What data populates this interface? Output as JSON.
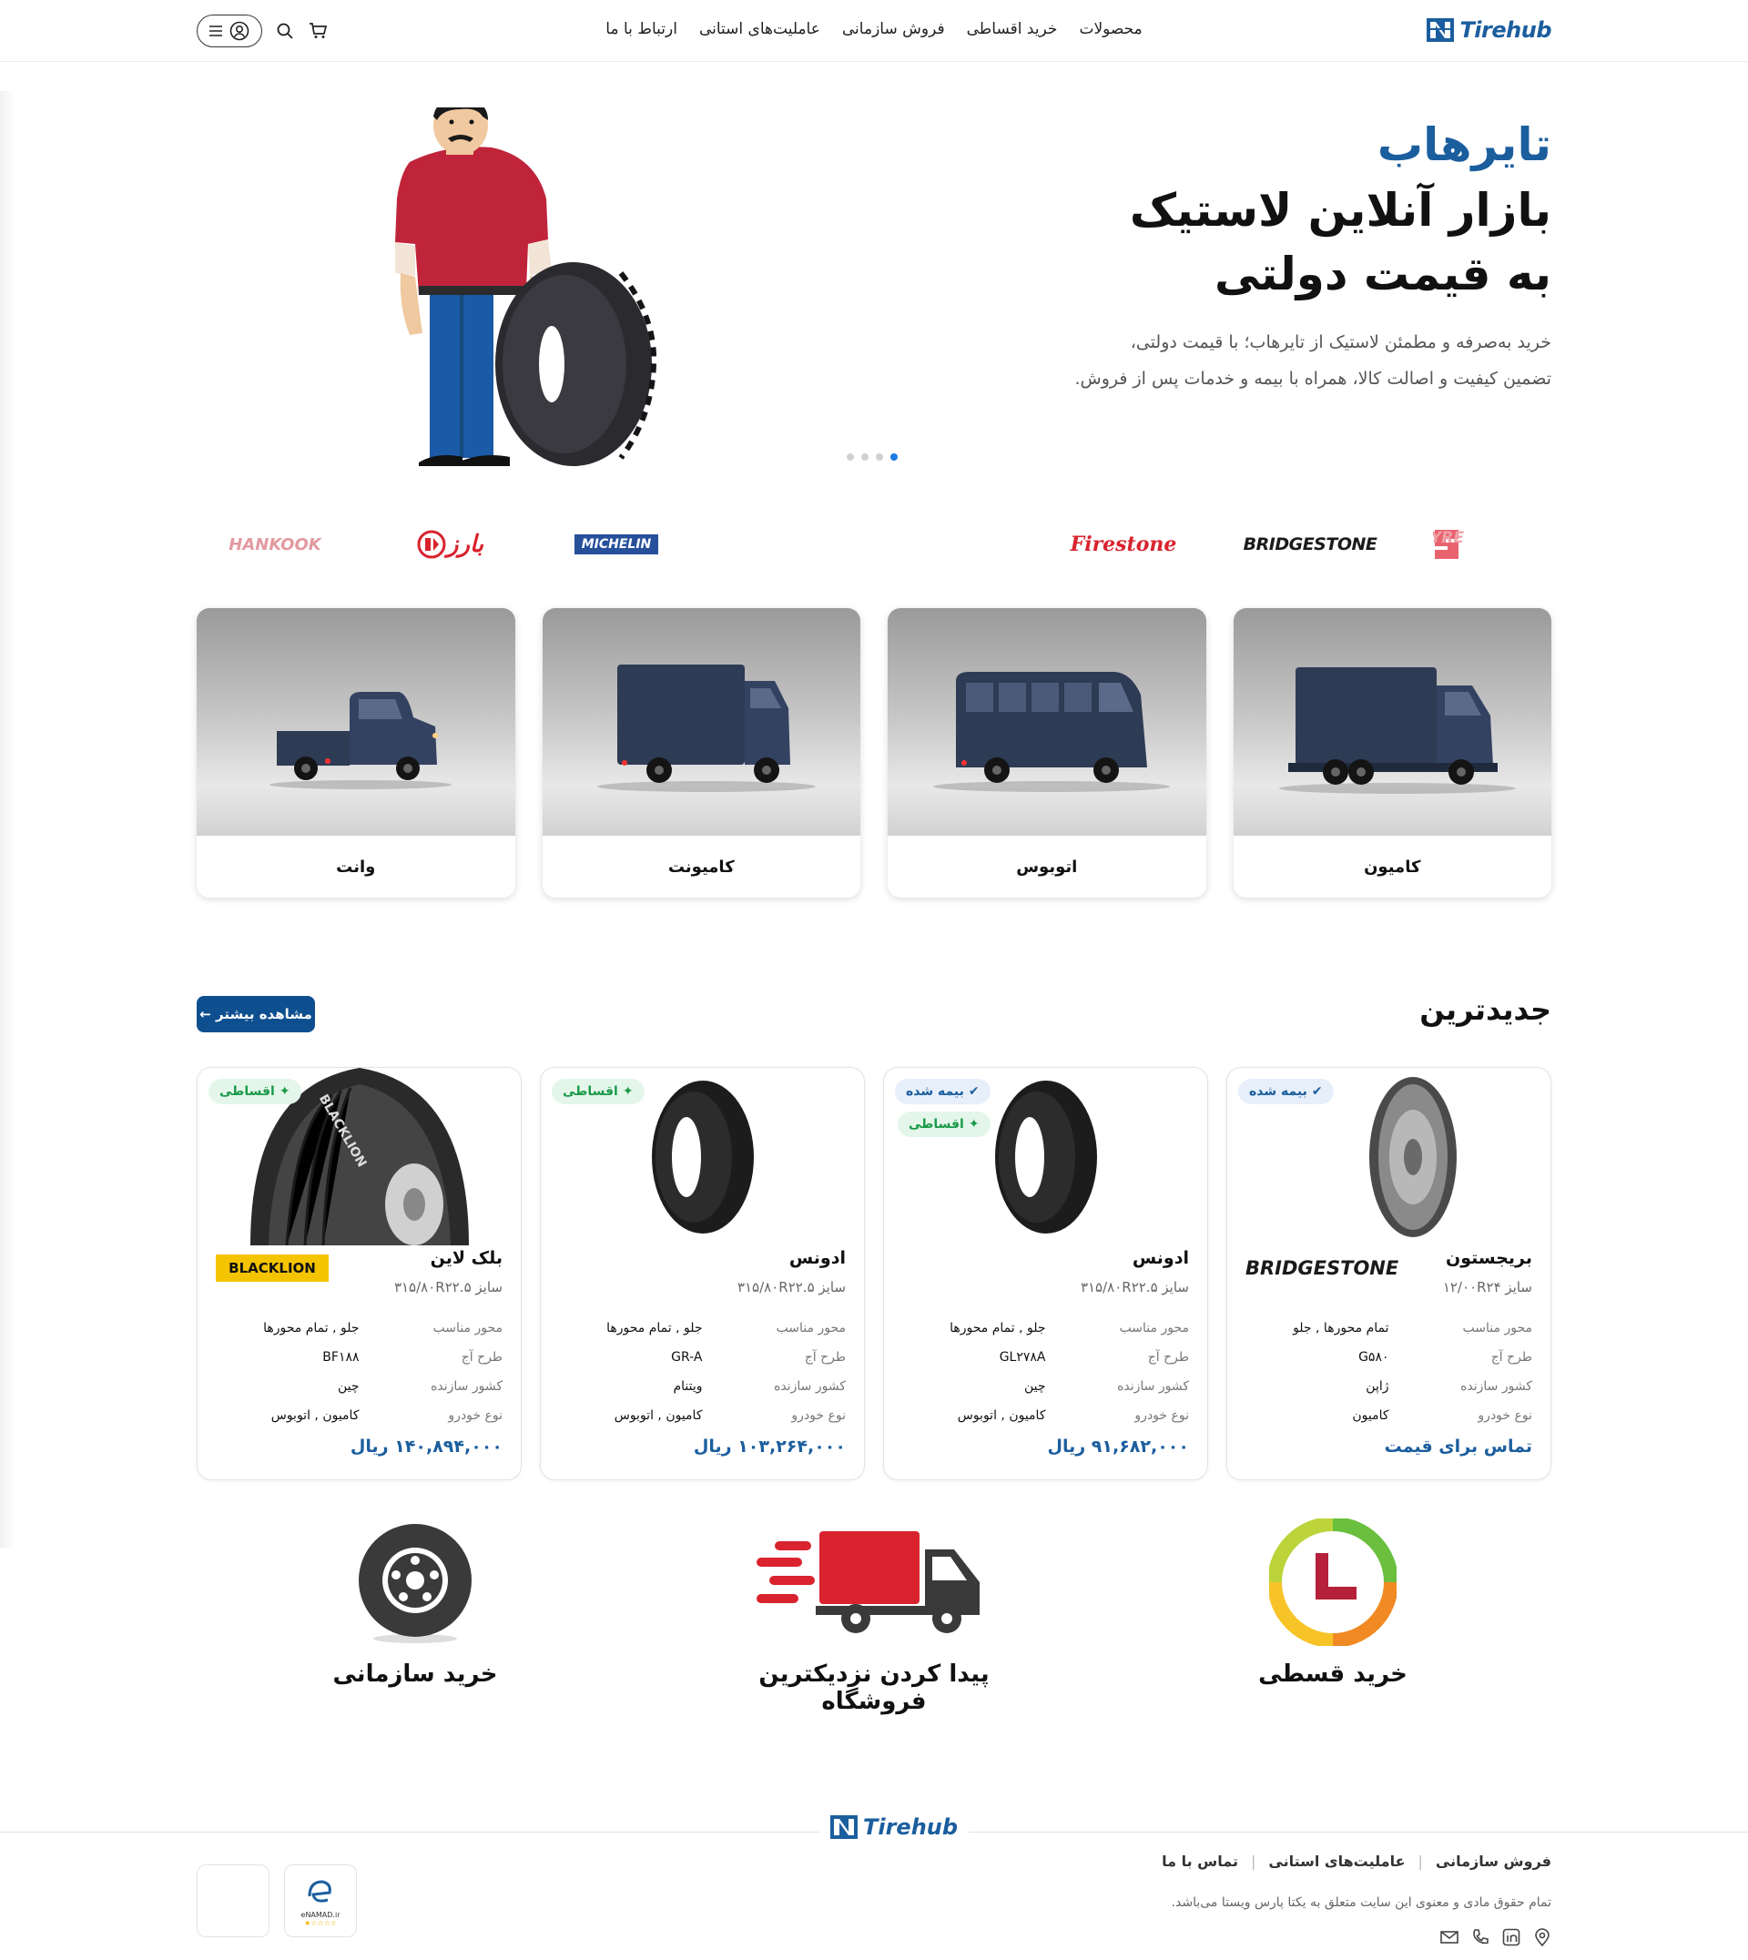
{
  "header": {
    "logo_text": "Tirehub",
    "nav": [
      "محصولات",
      "خرید اقساطی",
      "فروش سازمانی",
      "عاملیت‌های استانی",
      "ارتباط با ما"
    ]
  },
  "hero": {
    "title_accent": "تایرهاب",
    "title_line1": "بازار آنلاین لاستیک",
    "title_line2": "به قیمت دولتی",
    "desc_line1": "خرید به‌صرفه و مطمئن لاستیک از تایرهاب؛ با قیمت دولتی،",
    "desc_line2": "تضمین کیفیت و اصالت کالا، همراه با بیمه و خدمات پس از فروش.",
    "slides": 4,
    "active_slide": 4
  },
  "brands": [
    "SAMSON TYRE",
    "BRIDGESTONE",
    "Firestone",
    "MICHELIN",
    "بارز",
    "HANKOOK"
  ],
  "categories": [
    "کامیون",
    "اتوبوس",
    "کامیونت",
    "وانت"
  ],
  "newest": {
    "title": "جدیدترین",
    "more_label": "مشاهده بیشتر ←",
    "spec_labels": {
      "axle": "محور مناسب",
      "pattern": "طرح آج",
      "country": "کشور سازنده",
      "vehicle": "نوع خودرو"
    },
    "products": [
      {
        "name": "بریجستون",
        "size": "سایز ۱۲/۰۰R۲۴",
        "brand_logo": "BRIDGESTONE",
        "badges": [
          "بیمه شده"
        ],
        "axle": "تمام محورها , جلو",
        "pattern": "G۵۸۰",
        "country": "ژاپن",
        "vehicle": "کامیون",
        "price": "تماس برای قیمت"
      },
      {
        "name": "ادونس",
        "size": "سایز ۳۱۵/۸۰R۲۲.۵",
        "brand_logo": "",
        "badges": [
          "بیمه شده",
          "اقساطی"
        ],
        "axle": "جلو , تمام محورها",
        "pattern": "GL۲۷۸A",
        "country": "چین",
        "vehicle": "کامیون , اتوبوس",
        "price": "۹۱,۶۸۲,۰۰۰ ریال"
      },
      {
        "name": "ادونس",
        "size": "سایز ۳۱۵/۸۰R۲۲.۵",
        "brand_logo": "",
        "badges": [
          "اقساطی"
        ],
        "axle": "جلو , تمام محورها",
        "pattern": "GR-A",
        "country": "ویتنام",
        "vehicle": "کامیون , اتوبوس",
        "price": "۱۰۳,۲۶۴,۰۰۰ ریال"
      },
      {
        "name": "بلک لاین",
        "size": "سایز ۳۱۵/۸۰R۲۲.۵",
        "brand_logo": "BLACKLION",
        "badges": [
          "اقساطی"
        ],
        "axle": "جلو , تمام محورها",
        "pattern": "BF۱۸۸",
        "country": "چین",
        "vehicle": "کامیون , اتوبوس",
        "price": "۱۴۰,۸۹۴,۰۰۰ ریال"
      }
    ]
  },
  "features": [
    "خرید قسطی",
    "پیدا کردن نزدیکترین فروشگاه",
    "خرید سازمانی"
  ],
  "footer": {
    "logo_text": "Tirehub",
    "links": [
      "فروش سازمانی",
      "عاملیت‌های استانی",
      "تماس با ما"
    ],
    "copyright": "تمام حقوق مادی و معنوی این سایت متعلق به یکتا پارس ویستا می‌باشد.",
    "enamad_text": "eNAMAD.ir"
  },
  "colors": {
    "primary": "#1b5e9e",
    "button": "#0e4f8f",
    "installment": "#1a9a48"
  }
}
